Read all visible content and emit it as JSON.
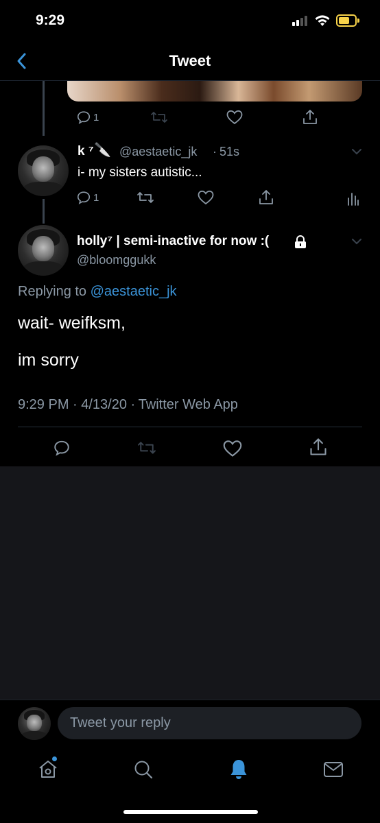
{
  "status_bar": {
    "time": "9:29"
  },
  "header": {
    "title": "Tweet"
  },
  "parent_tweet": {
    "reply_count": "1"
  },
  "reply_tweet": {
    "name": "k ⁷",
    "name_emoji": "🔪",
    "handle": "@aestaetic_jk",
    "separator": "·",
    "time": "51s",
    "text": "i- my sisters autistic...",
    "reply_count": "1"
  },
  "main_tweet": {
    "name": "holly⁷ | semi-inactive for now :(",
    "handle": "@bloomggukk",
    "replying_prefix": "Replying to",
    "replying_to": "@aestaetic_jk",
    "line1": "wait- weifksm,",
    "line2": "im sorry",
    "timestamp": "9:29 PM · 4/13/20 ·",
    "source": "Twitter Web App"
  },
  "composer": {
    "placeholder": "Tweet your reply"
  },
  "colors": {
    "accent": "#3b94d9",
    "muted": "#8b98a5",
    "battery": "#f8d34a"
  },
  "icons": [
    "back-chevron-icon",
    "reply-icon",
    "retweet-icon",
    "like-icon",
    "share-icon",
    "analytics-icon",
    "lock-icon",
    "chevron-down-icon",
    "home-icon",
    "search-icon",
    "notifications-icon",
    "messages-icon"
  ]
}
